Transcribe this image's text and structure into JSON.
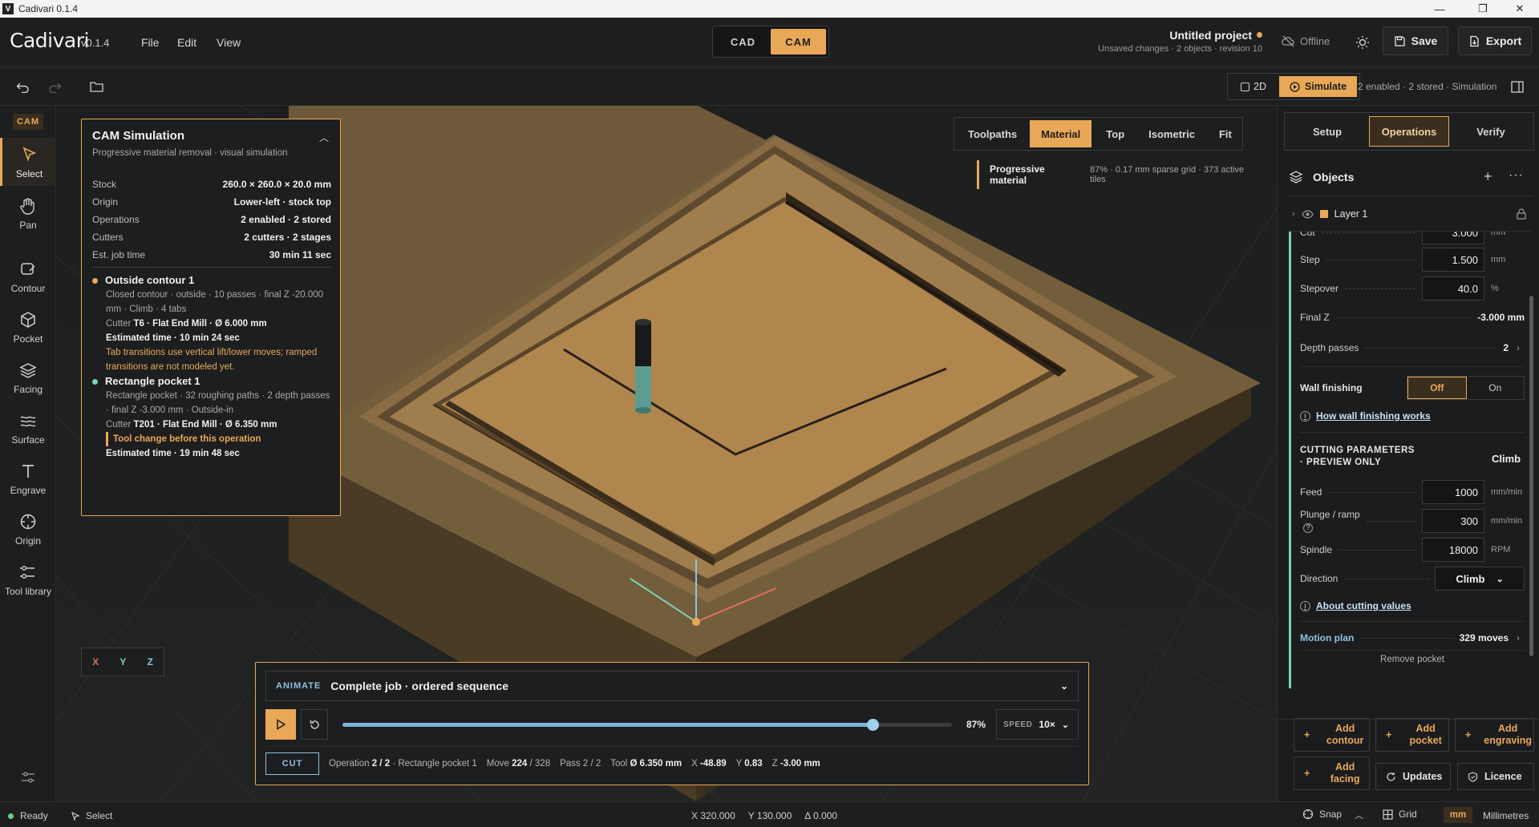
{
  "window": {
    "title": "Cadivari 0.1.4",
    "logo_letter": "V"
  },
  "header": {
    "brand": "Cadivari",
    "version": "v0.1.4",
    "menu": [
      "File",
      "Edit",
      "View"
    ],
    "modes": [
      "CAD",
      "CAM"
    ],
    "active_mode": "CAM",
    "project_title": "Untitled project",
    "project_status": "Unsaved changes · 2 objects · revision 10",
    "offline_label": "Offline",
    "save_label": "Save",
    "export_label": "Export"
  },
  "toolbar": {
    "toggle_2d": "2D",
    "simulate": "Simulate",
    "summary": "2 enabled · 2 stored · Simulation"
  },
  "left_tools": {
    "mode_tag": "CAM",
    "items": [
      {
        "label": "Select",
        "icon": "cursor-icon"
      },
      {
        "label": "Pan",
        "icon": "hand-icon"
      },
      {
        "label": "Contour",
        "icon": "contour-icon"
      },
      {
        "label": "Pocket",
        "icon": "cube-icon"
      },
      {
        "label": "Facing",
        "icon": "layers-icon"
      },
      {
        "label": "Surface",
        "icon": "waves-icon"
      },
      {
        "label": "Engrave",
        "icon": "text-icon"
      },
      {
        "label": "Origin",
        "icon": "crosshair-icon"
      },
      {
        "label": "Tool library",
        "icon": "tool-library-icon"
      }
    ]
  },
  "sim_panel": {
    "title": "CAM Simulation",
    "subtitle": "Progressive material removal · visual simulation",
    "stats": [
      {
        "k": "Stock",
        "v": "260.0 × 260.0 × 20.0 mm"
      },
      {
        "k": "Origin",
        "v": "Lower-left · stock top"
      },
      {
        "k": "Operations",
        "v": "2 enabled · 2 stored"
      },
      {
        "k": "Cutters",
        "v": "2 cutters · 2 stages"
      },
      {
        "k": "Est. job time",
        "v": "30 min 11 sec"
      }
    ],
    "op1": {
      "name": "Outside contour 1",
      "desc": "Closed contour · outside · 10 passes · final Z -20.000 mm · Climb · 4 tabs",
      "cutter_prefix": "Cutter",
      "cutter": "T6 · Flat End Mill · Ø 6.000 mm",
      "time": "Estimated time · 10 min 24 sec",
      "note": "Tab transitions use vertical lift/lower moves; ramped transitions are not modeled yet.",
      "color": "#e8a857"
    },
    "op2": {
      "name": "Rectangle pocket 1",
      "desc": "Rectangle pocket · 32 roughing paths · 2 depth passes · final Z -3.000 mm · Outside-in",
      "cutter_prefix": "Cutter",
      "cutter": "T201 · Flat End Mill · Ø 6.350 mm",
      "toolchange": "Tool change before this operation",
      "time": "Estimated time · 19 min 48 sec",
      "color": "#7fd1b8"
    }
  },
  "view_tabs": [
    "Toolpaths",
    "Material",
    "Top",
    "Isometric",
    "Fit"
  ],
  "active_view_tab": "Material",
  "progressive": {
    "label": "Progressive material",
    "detail": "87% · 0.17 mm sparse grid · 373 active tiles"
  },
  "axes": {
    "x": "X",
    "y": "Y",
    "z": "Z"
  },
  "animate": {
    "tag": "ANIMATE",
    "selection": "Complete job · ordered sequence",
    "progress": 0.87,
    "percent_label": "87%",
    "speed_label": "SPEED",
    "speed_value": "10×",
    "state": "CUT",
    "status": {
      "operation_prefix": "Operation",
      "operation": "2 / 2",
      "operation_name": "· Rectangle pocket 1",
      "move_prefix": "Move",
      "move": "224",
      "move_total": "/ 328",
      "pass": "Pass 2 / 2",
      "tool_prefix": "Tool",
      "tool": "Ø 6.350 mm",
      "x_prefix": "X",
      "x": "-48.89",
      "y_prefix": "Y",
      "y": "0.83",
      "z_prefix": "Z",
      "z": "-3.00 mm"
    }
  },
  "right_panel": {
    "tabs": [
      "Setup",
      "Operations",
      "Verify"
    ],
    "active_tab": "Operations",
    "objects_title": "Objects",
    "layer_name": "Layer 1",
    "cut_partial": "Cut",
    "cut_partial_value": "3.000",
    "cut_partial_unit": "mm",
    "step": {
      "label": "Step",
      "value": "1.500",
      "unit": "mm"
    },
    "stepover": {
      "label": "Stepover",
      "value": "40.0",
      "unit": "%"
    },
    "final_z": {
      "label": "Final Z",
      "value": "-3.000 mm"
    },
    "depth_passes": {
      "label": "Depth passes",
      "value": "2"
    },
    "wall_finishing": {
      "label": "Wall finishing",
      "off": "Off",
      "on": "On"
    },
    "wall_link": "How wall finishing works",
    "cutting_header": "CUTTING PARAMETERS · PREVIEW ONLY",
    "cutting_mode": "Climb",
    "feed": {
      "label": "Feed",
      "value": "1000",
      "unit": "mm/min"
    },
    "plunge": {
      "label": "Plunge / ramp",
      "value": "300",
      "unit": "mm/min"
    },
    "spindle": {
      "label": "Spindle",
      "value": "18000",
      "unit": "RPM"
    },
    "direction": {
      "label": "Direction",
      "value": "Climb"
    },
    "about_link": "About cutting values",
    "motion_plan": {
      "label": "Motion plan",
      "value": "329 moves"
    },
    "remove_label": "Remove pocket",
    "add_buttons": [
      "Add contour",
      "Add pocket",
      "Add engraving",
      "Add facing"
    ],
    "updates_label": "Updates",
    "licence_label": "Licence"
  },
  "status_bar": {
    "ready": "Ready",
    "tool": "Select",
    "x_prefix": "X",
    "x": "320.000",
    "y_prefix": "Y",
    "y": "130.000",
    "delta_prefix": "Δ",
    "delta": "0.000",
    "snap": "Snap",
    "grid": "Grid",
    "unit_short": "mm",
    "unit_long": "Millimetres"
  }
}
